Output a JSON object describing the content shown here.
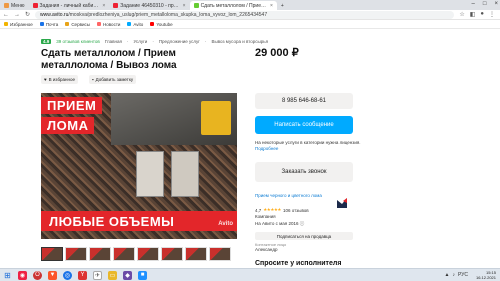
{
  "browser": {
    "tabs": [
      {
        "label": "Меню",
        "active": false
      },
      {
        "label": "Задания - личный каби…",
        "active": false
      },
      {
        "label": "Задание 46450310 - пр…",
        "active": false
      },
      {
        "label": "Сдать металлолом / Прие…",
        "active": true
      }
    ],
    "url_domain": "www.avito.ru",
    "url_path": "/moskva/predlozheniya_uslug/priem_metallolomа_skupka_loma_vyvoz_lom_2265434547",
    "bookmarks": [
      "Избранное",
      "Почта",
      "Сервисы",
      "Новости",
      "Avito",
      "Youtube"
    ]
  },
  "listing": {
    "rating_badge": "4.9",
    "reviews_link": "39 отзывов клиентов",
    "breadcrumbs": [
      "Главная",
      "Услуги",
      "Предложение услуг",
      "Вывоз мусора и вторсырья"
    ],
    "title": "Сдать металлолом / Прием металлолома / Вывоз лома",
    "price": "29 000 ₽",
    "favorite_label": "В избранное",
    "note_label": "Добавить заметку",
    "photo_text_1": "ПРИЕМ",
    "photo_text_2": "ЛОМА",
    "photo_text_3": "ЛЮБЫЕ ОБЪЕМЫ",
    "photo_watermark": "Avito"
  },
  "sidebar": {
    "phone": "8 985 646-68-61",
    "message_label": "Написать сообщение",
    "license_text": "На некоторые услуги в категории нужна лицензия.",
    "license_link": "Подробнее",
    "call_label": "Заказать звонок",
    "seller_name": "Прием черного и цветного лома",
    "seller_rating": "4,7",
    "seller_reviews": "106 отзывов",
    "seller_type": "Компания",
    "seller_since": "На Авито с мая 2016",
    "subscribe_label": "Подписаться на продавца",
    "contact_label": "Контактное лицо",
    "contact_name": "Александр",
    "ask_title": "Спросите у исполнителя"
  },
  "taskbar": {
    "time": "15:15",
    "date": "16.12.2021",
    "lang": "РУС"
  },
  "colors": {
    "accent_blue": "#00aaff",
    "badge_green": "#2aa84a",
    "photo_red": "#e3262a"
  }
}
